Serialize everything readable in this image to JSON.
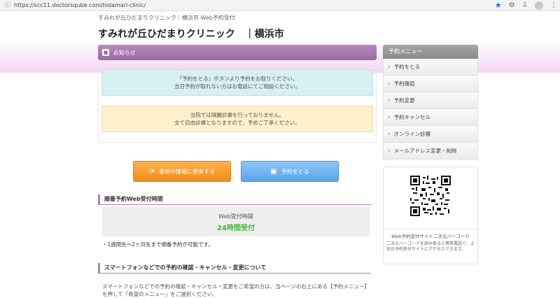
{
  "browser": {
    "url": "https://scc11.doctorsqube.com/hidamari-clinic/",
    "icons": {
      "info": "info-icon",
      "bookmark": "star-icon",
      "extensions": "puzzle-icon",
      "profile": "avatar"
    }
  },
  "header": {
    "subtitle": "すみれが丘ひだまりクリニック｜横浜市 Web予約受付",
    "title": "すみれが丘ひだまりクリニック　｜横浜市"
  },
  "main": {
    "section_title": "お知らせ",
    "notice_blue": [
      "「予約をとる」ボタンより予約をお取りください。",
      "当日予約が取れない方はお電話にてご相談ください。"
    ],
    "notice_yellow": [
      "当院では隔離診療を行っておりません。",
      "全て自由診療となりますので、予めご了承ください。"
    ],
    "buttons": {
      "history": "最新の情報に更新する",
      "reserve": "予約をとる"
    },
    "web_section": {
      "heading": "順番予約Web受付時間",
      "label": "Web受付時間",
      "value": "24時間受付",
      "note": "・1週間先～2ヶ月先まで順番予約が可能です。"
    },
    "smartphone_section": {
      "heading": "スマートフォンなどでの予約の確認・キャンセル・変更について",
      "text": "スマートフォンなどでの予約の確認・キャンセル・変更をご希望の方は、当ページの右上にある【予約メニュー】を押して「希望のメニュー」をご選択ください。"
    }
  },
  "sidebar": {
    "title": "予約メニュー",
    "items": [
      {
        "label": "予約をとる"
      },
      {
        "label": "予約確認"
      },
      {
        "label": "予約変更"
      },
      {
        "label": "予約キャンセル"
      },
      {
        "label": "オンライン診療"
      },
      {
        "label": "メールアドレス変更・削除"
      }
    ],
    "qr": {
      "caption": "Web予約受付サイト二次元バーコード",
      "desc": "二次元バーコードを読み取ると携帯電話で、上記の予約受付サイトにアクセスできます。"
    }
  }
}
